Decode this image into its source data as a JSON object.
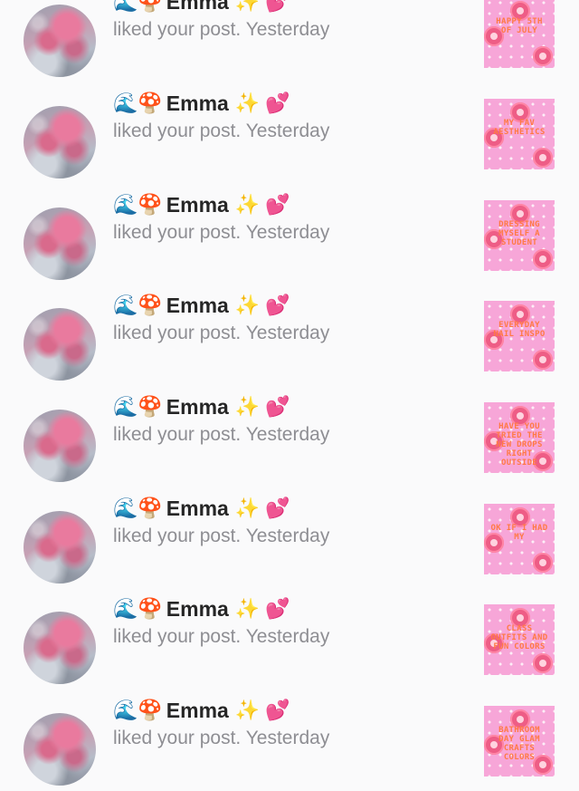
{
  "notifications": [
    {
      "name": "Emma",
      "emoji_before": "🌊🍄",
      "emoji_after": "✨ 💕",
      "action": "liked your post.",
      "time": "Yesterday",
      "thumb_text": "Happy 5th of July"
    },
    {
      "name": "Emma",
      "emoji_before": "🌊🍄",
      "emoji_after": "✨ 💕",
      "action": "liked your post.",
      "time": "Yesterday",
      "thumb_text": "My Fav Aesthetics"
    },
    {
      "name": "Emma",
      "emoji_before": "🌊🍄",
      "emoji_after": "✨ 💕",
      "action": "liked your post.",
      "time": "Yesterday",
      "thumb_text": "Dressing myself a student"
    },
    {
      "name": "Emma",
      "emoji_before": "🌊🍄",
      "emoji_after": "✨ 💕",
      "action": "liked your post.",
      "time": "Yesterday",
      "thumb_text": "Everyday nail inspo"
    },
    {
      "name": "Emma",
      "emoji_before": "🌊🍄",
      "emoji_after": "✨ 💕",
      "action": "liked your post.",
      "time": "Yesterday",
      "thumb_text": "Have you tried the new drops right outside"
    },
    {
      "name": "Emma",
      "emoji_before": "🌊🍄",
      "emoji_after": "✨ 💕",
      "action": "liked your post.",
      "time": "Yesterday",
      "thumb_text": "OK if I had my"
    },
    {
      "name": "Emma",
      "emoji_before": "🌊🍄",
      "emoji_after": "✨ 💕",
      "action": "liked your post.",
      "time": "Yesterday",
      "thumb_text": "Class outfits and fun colors"
    },
    {
      "name": "Emma",
      "emoji_before": "🌊🍄",
      "emoji_after": "✨ 💕",
      "action": "liked your post.",
      "time": "Yesterday",
      "thumb_text": "Bathroom day glam crafts colors"
    }
  ],
  "colors": {
    "background": "#fafafb",
    "name_text": "#262626",
    "secondary_text": "#8e8e93",
    "thumb_pink": "#f7a6d8",
    "thumb_text_orange": "#ff7a45",
    "flower_red": "#ee5d86"
  },
  "icons": {
    "emoji_before": [
      "wave",
      "mushroom"
    ],
    "emoji_after": [
      "sparkles",
      "two-hearts"
    ]
  }
}
